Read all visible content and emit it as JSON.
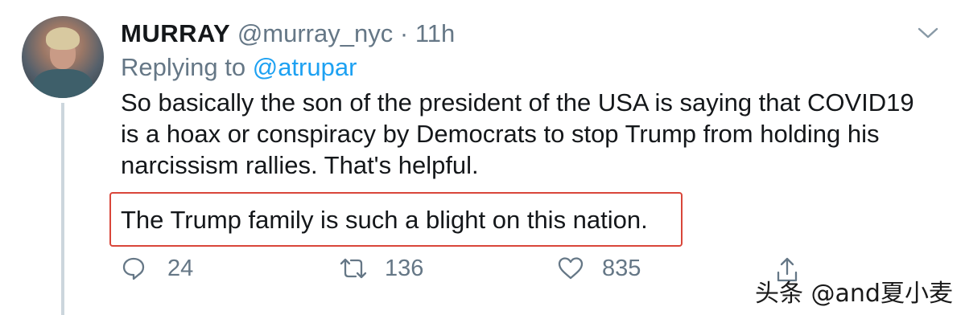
{
  "tweet": {
    "display_name": "MURRAY",
    "handle": "@murray_nyc",
    "separator": "·",
    "time": "11h",
    "replying_prefix": "Replying to",
    "replying_to": "@atrupar",
    "text": "So basically the son of the president of the USA is saying that COVID19 is a hoax or conspiracy by Democrats to stop Trump from holding his narcissism rallies. That's helpful.",
    "highlighted_text": "The Trump family is such a blight on this nation."
  },
  "actions": {
    "reply_count": "24",
    "retweet_count": "136",
    "like_count": "835"
  },
  "icons": [
    "avatar",
    "chevron-down-icon",
    "reply-icon",
    "retweet-icon",
    "like-icon",
    "share-icon"
  ],
  "colors": {
    "text": "#14171a",
    "secondary": "#657786",
    "link": "#1da1f2",
    "highlight_border": "#d9463a",
    "thread_line": "#ccd6dd"
  },
  "watermark": "头条 @and夏小麦"
}
